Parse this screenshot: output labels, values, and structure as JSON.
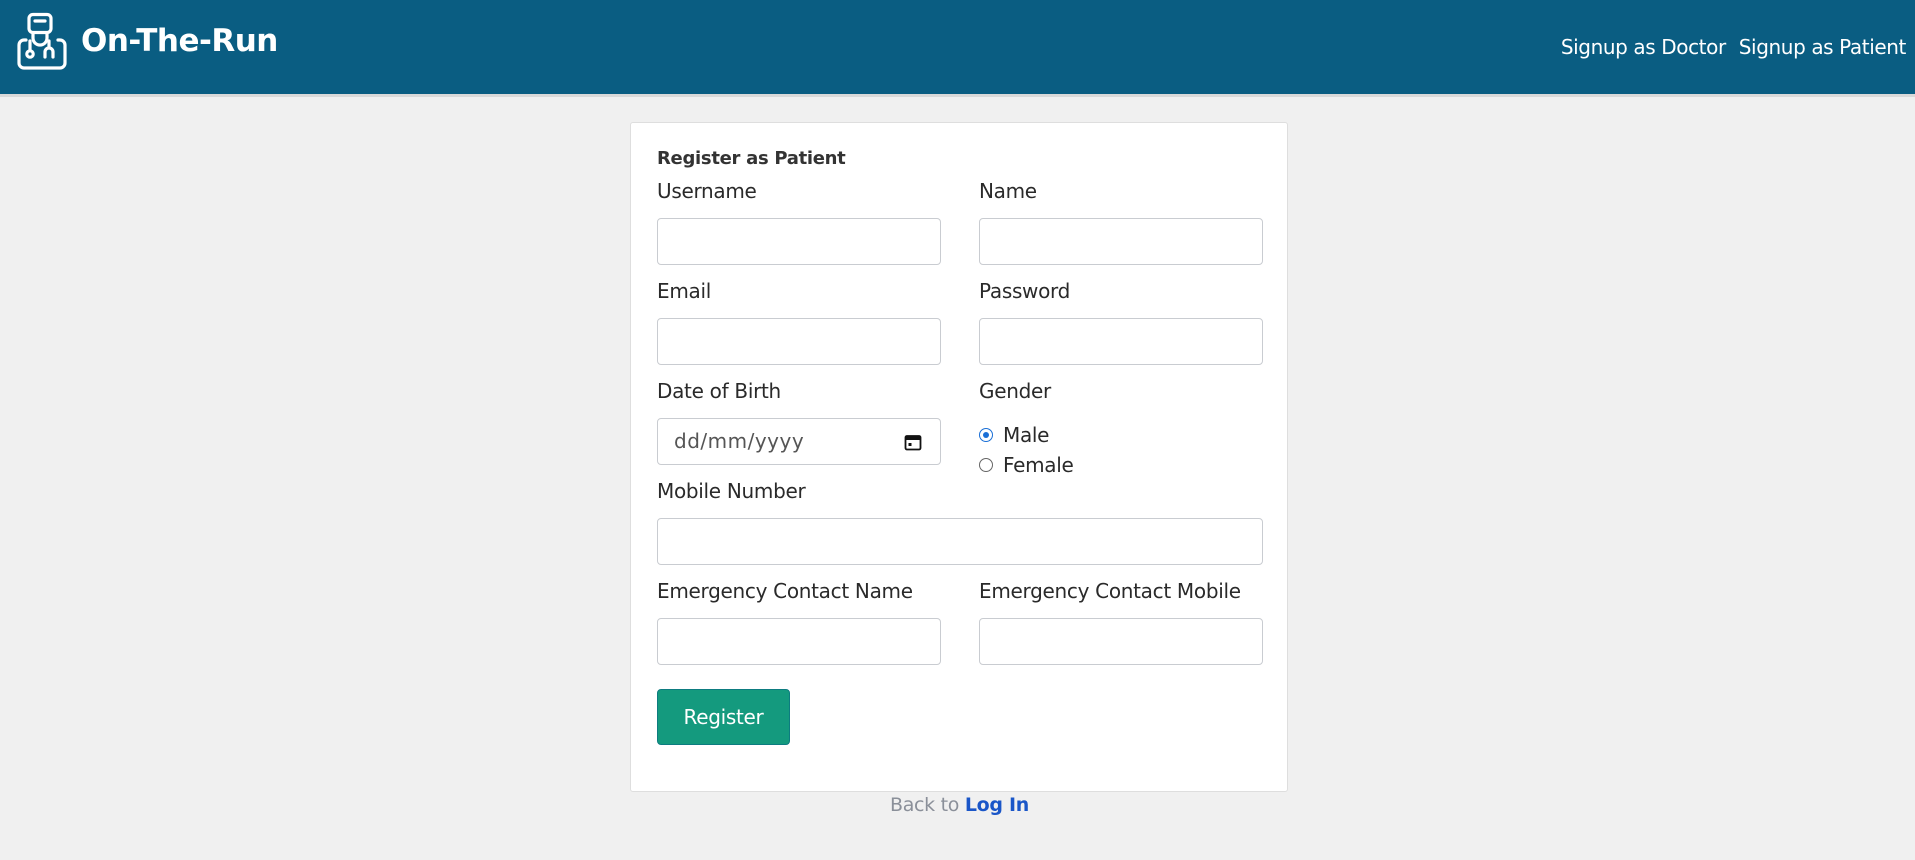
{
  "navbar": {
    "brand": "On-The-Run",
    "links": [
      "Signup as Doctor",
      "Signup as Patient"
    ]
  },
  "form": {
    "title": "Register as Patient",
    "fields": {
      "username": {
        "label": "Username",
        "value": ""
      },
      "name": {
        "label": "Name",
        "value": ""
      },
      "email": {
        "label": "Email",
        "value": ""
      },
      "password": {
        "label": "Password",
        "value": ""
      },
      "dob": {
        "label": "Date of Birth",
        "placeholder": "dd/mm/yyyy"
      },
      "gender": {
        "label": "Gender",
        "options": [
          "Male",
          "Female"
        ],
        "selected": "Male"
      },
      "mobile": {
        "label": "Mobile Number",
        "value": ""
      },
      "emergency_name": {
        "label": "Emergency Contact Name",
        "value": ""
      },
      "emergency_mobile": {
        "label": "Emergency Contact Mobile",
        "value": ""
      }
    },
    "submit_label": "Register"
  },
  "footer": {
    "text": "Back to",
    "link": "Log In"
  },
  "colors": {
    "navbar_bg": "#0a5d82",
    "button_bg": "#149a7e",
    "link": "#1a56c8",
    "page_bg": "#f0f0f0"
  }
}
